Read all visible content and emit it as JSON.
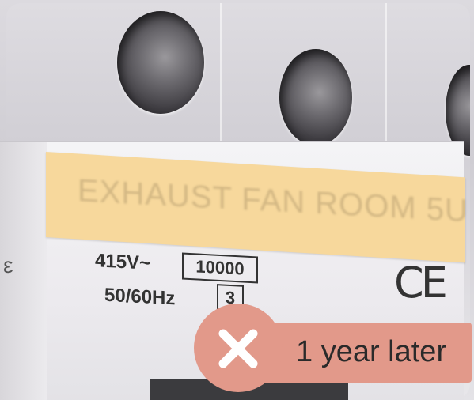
{
  "label": {
    "text": "EXHAUST FAN ROOM 5U"
  },
  "specs": {
    "voltage": "415V~",
    "frequency": "50/60Hz",
    "rating_box": "10000",
    "class_box": "3",
    "cert_mark": "CE"
  },
  "badge": {
    "text": "1 year later",
    "icon": "close-icon",
    "color": "#e2998a"
  },
  "colors": {
    "label_strip": "#f7d89c",
    "badge": "#e2998a"
  }
}
